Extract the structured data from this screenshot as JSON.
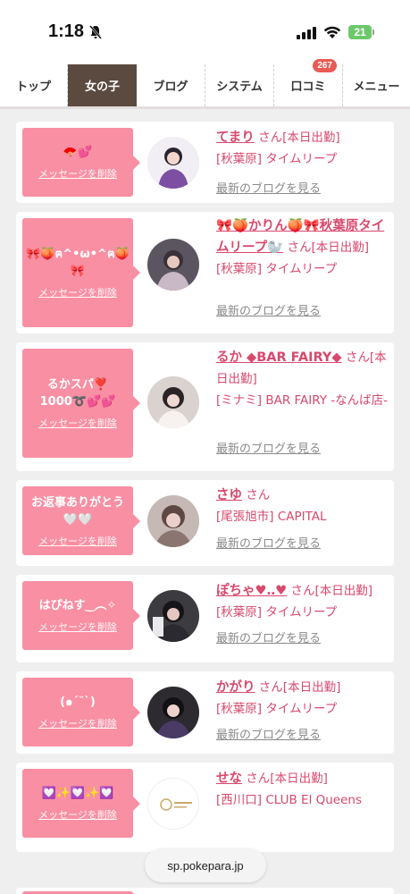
{
  "status": {
    "time": "1:18",
    "battery": "21"
  },
  "nav": {
    "tabs": [
      {
        "label": "トップ"
      },
      {
        "label": "女の子"
      },
      {
        "label": "ブログ"
      },
      {
        "label": "システム"
      },
      {
        "label": "口コミ",
        "badge": "267"
      },
      {
        "label": "メニュー"
      }
    ]
  },
  "cards": [
    {
      "message": "🪭💕",
      "delete": "メッセージを削除",
      "name": "てまり",
      "san": "さん",
      "tag": "[本日出勤]",
      "shop": "[秋葉原] タイムリープ",
      "blog": "最新のブログを見る"
    },
    {
      "message": "🎀🍑ฅ^•ω•^ฅ🍑🎀",
      "delete": "メッセージを削除",
      "name": "🎀🍑かりん🍑🎀秋葉原タイムリープ🦭",
      "san": "さん",
      "tag": "[本日出勤]",
      "shop": "[秋葉原] タイムリープ",
      "blog": "最新のブログを見る"
    },
    {
      "message": "るかスパ❣️ 1000➰💕💕",
      "delete": "メッセージを削除",
      "name": "るか ◆BAR FAIRY◆",
      "san": "さん",
      "tag": "[本日出勤]",
      "shop": "[ミナミ] BAR FAIRY -なんば店-",
      "blog": "最新のブログを見る"
    },
    {
      "message": "お返事ありがとう🤍🤍",
      "delete": "メッセージを削除",
      "name": "さゆ",
      "san": "さん",
      "tag": "",
      "shop": "[尾張旭市] CAPITAL",
      "blog": "最新のブログを見る"
    },
    {
      "message": "はぴねす‿︵✧",
      "delete": "メッセージを削除",
      "name": "ぽちゃ♥︎‥♥︎",
      "san": "さん",
      "tag": "[本日出勤]",
      "shop": "[秋葉原] タイムリープ",
      "blog": "最新のブログを見る"
    },
    {
      "message": "(๑ˊ˘ˋ)",
      "delete": "メッセージを削除",
      "name": "かがり",
      "san": "さん",
      "tag": "[本日出勤]",
      "shop": "[秋葉原] タイムリープ",
      "blog": "最新のブログを見る"
    },
    {
      "message": "💟✨💟✨💟",
      "delete": "メッセージを削除",
      "name": "せな",
      "san": "さん",
      "tag": "[本日出勤]",
      "shop": "[西川口] CLUB El Queens",
      "blog": ""
    }
  ],
  "url": "sp.pokepara.jp",
  "colors": {
    "accent": "#d8496d",
    "message_bg": "#f98fa3",
    "tab_active": "#5b4a3f"
  }
}
